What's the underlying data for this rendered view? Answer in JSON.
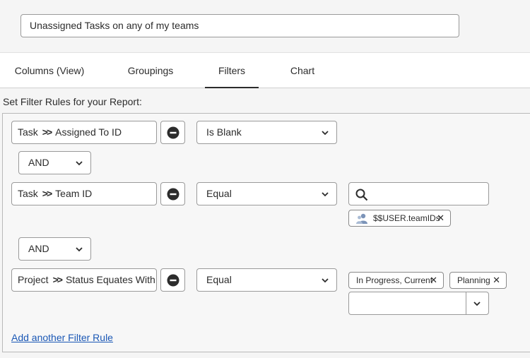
{
  "report": {
    "name": "Unassigned Tasks on any of my teams"
  },
  "tabs": [
    "Columns (View)",
    "Groupings",
    "Filters",
    "Chart"
  ],
  "active_tab": "Filters",
  "section_label": "Set Filter Rules for your Report:",
  "rules": [
    {
      "object": "Task",
      "field": "Assigned To ID",
      "operator": "Is Blank"
    },
    {
      "object": "Task",
      "field": "Team ID",
      "operator": "Equal",
      "value_tags": [
        "$$USER.teamIDs"
      ]
    },
    {
      "object": "Project",
      "field": "Status Equates With",
      "operator": "Equal",
      "value_tags": [
        "In Progress, Current",
        "Planning"
      ]
    }
  ],
  "conjunctions": [
    "AND",
    "AND"
  ],
  "add_rule_link": "Add another Filter Rule",
  "icons": {
    "separator": "double-chevron-right-icon",
    "remove": "minus-circle-icon",
    "dropdown": "chevron-down-icon",
    "search": "search-icon",
    "user_tag": "user-icon",
    "tag_remove": "close-icon"
  },
  "colors": {
    "link": "#1a57b5",
    "user_icon": "#7b93b8"
  }
}
